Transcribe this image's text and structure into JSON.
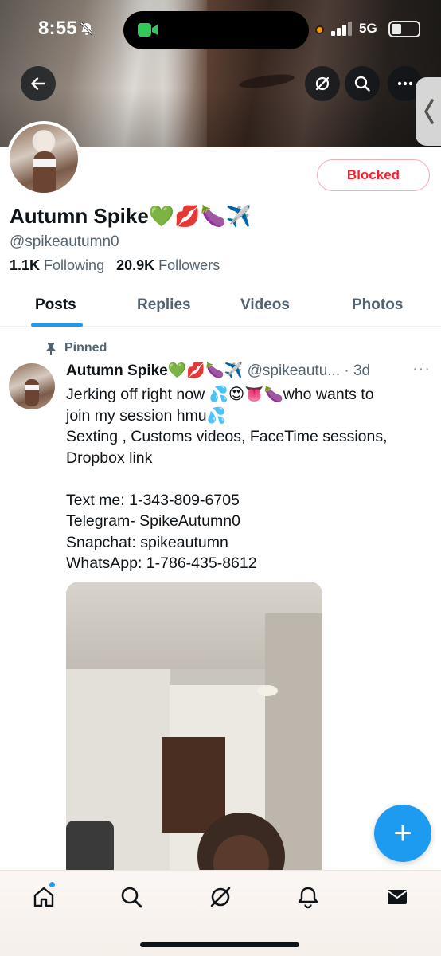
{
  "status_bar": {
    "time": "8:55",
    "network": "5G",
    "icons": [
      "bell-slash-icon",
      "facetime-camera-icon",
      "orange-dot-indicator",
      "signal-bars-icon",
      "battery-icon"
    ]
  },
  "header": {
    "icons": [
      "back-arrow-icon",
      "grok-icon",
      "search-icon",
      "more-horizontal-icon"
    ]
  },
  "profile": {
    "display_name": "Autumn Spike💚💋🍆✈️",
    "handle": "@spikeautumn0",
    "following_count": "1.1K",
    "following_label": "Following",
    "followers_count": "20.9K",
    "followers_label": "Followers",
    "relationship_button": "Blocked"
  },
  "tabs": [
    {
      "label": "Posts",
      "active": true
    },
    {
      "label": "Replies",
      "active": false
    },
    {
      "label": "Videos",
      "active": false
    },
    {
      "label": "Photos",
      "active": false
    }
  ],
  "pinned_post": {
    "pinned_label": "Pinned",
    "author": "Autumn Spike💚💋🍆✈️",
    "handle_time": " @spikeautu... · 3d",
    "lines": [
      "Jerking off right now 💦😍👅🍆who wants to",
      "join my session hmu💦",
      "Sexting , Customs videos, FaceTime sessions,",
      "Dropbox link",
      "",
      "Text me: 1-343-809-6705",
      "Telegram- SpikeAutumn0",
      "Snapchat: spikeautumn",
      "WhatsApp: 1-786-435-8612"
    ]
  },
  "fab": {
    "label": "+"
  },
  "bottom_nav": {
    "icons": [
      "home-icon",
      "search-icon",
      "grok-icon",
      "notifications-bell-icon",
      "messages-envelope-icon"
    ]
  },
  "colors": {
    "accent": "#1d9bf0",
    "blocked_red": "#f4212e",
    "secondary_text": "#536471"
  }
}
